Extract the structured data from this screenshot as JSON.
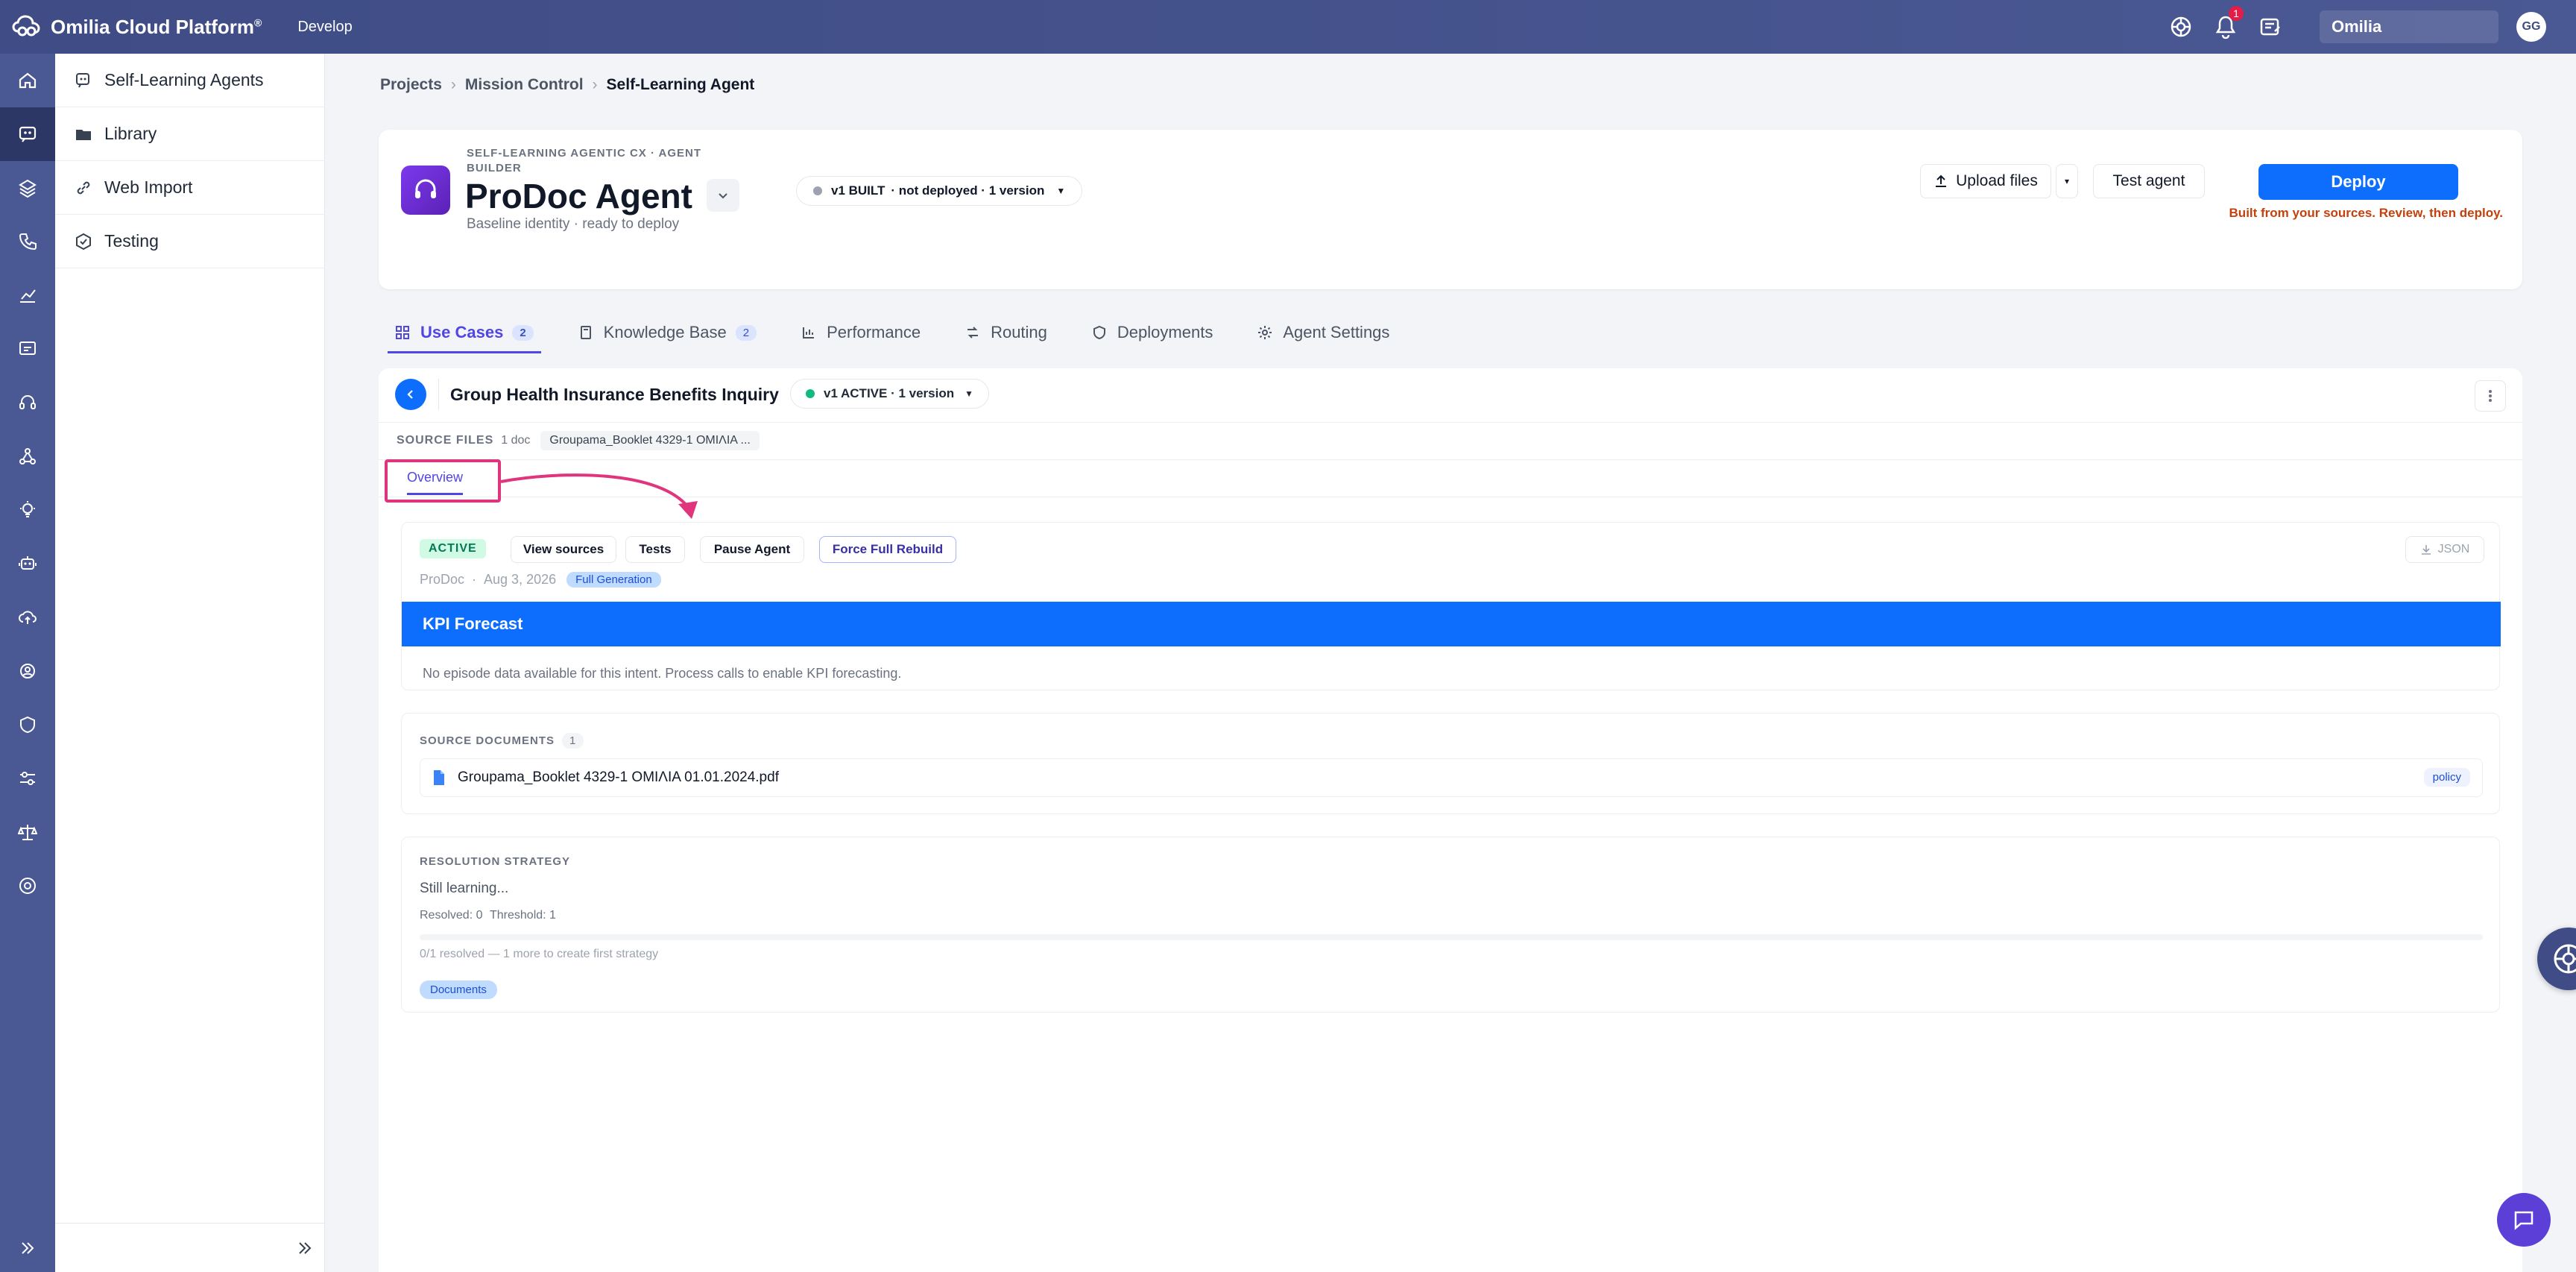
{
  "topbar": {
    "brand": "Omilia Cloud Platform",
    "brand_mark": "®",
    "env": "Develop",
    "notifications_count": "1",
    "org": "Omilia",
    "user_initials": "GG"
  },
  "rail": {
    "icons": [
      "home-icon",
      "agents-icon",
      "layers-icon",
      "phone-icon",
      "analytics-icon",
      "dialog-icon",
      "headset-icon",
      "flow-icon",
      "bulb-icon",
      "robot-icon",
      "cloud-upload-icon",
      "settings-cog-icon",
      "shield-icon",
      "tuning-icon",
      "scale-icon",
      "support-icon"
    ],
    "active_index": 1
  },
  "sidebar": {
    "items": [
      {
        "label": "Self-Learning Agents",
        "icon": "agent-icon"
      },
      {
        "label": "Library",
        "icon": "folder-icon"
      },
      {
        "label": "Web Import",
        "icon": "link-icon"
      },
      {
        "label": "Testing",
        "icon": "test-icon"
      }
    ]
  },
  "breadcrumb": {
    "items": [
      "Projects",
      "Mission Control"
    ],
    "current": "Self-Learning Agent"
  },
  "agent": {
    "eyebrow": "SELF-LEARNING AGENTIC CX · AGENT BUILDER",
    "title": "ProDoc Agent",
    "subtitle": "Baseline identity · ready to deploy",
    "version_status": "v1 BUILT",
    "version_detail": "· not deployed · 1 version",
    "upload_label": "Upload files",
    "test_label": "Test agent",
    "deploy_label": "Deploy",
    "deploy_note": "Built from your sources. Review, then deploy."
  },
  "tabs": [
    {
      "label": "Use Cases",
      "count": "2",
      "icon": "grid-icon"
    },
    {
      "label": "Knowledge Base",
      "count": "2",
      "icon": "book-icon"
    },
    {
      "label": "Performance",
      "icon": "chart-icon"
    },
    {
      "label": "Routing",
      "icon": "routing-icon"
    },
    {
      "label": "Deployments",
      "icon": "shield-icon"
    },
    {
      "label": "Agent Settings",
      "icon": "gear-icon"
    }
  ],
  "use_case": {
    "title": "Group Health Insurance Benefits Inquiry",
    "version": "v1 ACTIVE · 1 version",
    "source_files_label": "SOURCE FILES",
    "source_files_count": "1 doc",
    "source_file_chip": "Groupama_Booklet 4329-1 ΟΜΙΛΙΑ ...",
    "overview_tab": "Overview",
    "status_badge": "ACTIVE",
    "actions": [
      "View sources",
      "Tests",
      "Pause Agent",
      "Force Full Rebuild"
    ],
    "json_label": "JSON",
    "meta_author": "ProDoc",
    "meta_date": "Aug 3, 2026",
    "meta_chip": "Full Generation",
    "kpi_title": "KPI Forecast",
    "kpi_empty": "No episode data available for this intent. Process calls to enable KPI forecasting.",
    "source_docs_label": "SOURCE DOCUMENTS",
    "source_docs_count": "1",
    "doc_name": "Groupama_Booklet 4329-1 ΟΜΙΛΙΑ 01.01.2024.pdf",
    "doc_tag": "policy",
    "resolution_label": "RESOLUTION STRATEGY",
    "resolution_status": "Still learning...",
    "resolved": "Resolved: 0",
    "threshold": "Threshold: 1",
    "progress_text": "0/1 resolved — 1 more to create first strategy",
    "progress_fraction": 0,
    "documents_chip": "Documents"
  },
  "colors": {
    "topbar": "#3f4c85",
    "accent": "#0d6efd",
    "tab_active": "#4f46e5",
    "highlight": "#e0357d",
    "active_dot": "#10b981"
  }
}
